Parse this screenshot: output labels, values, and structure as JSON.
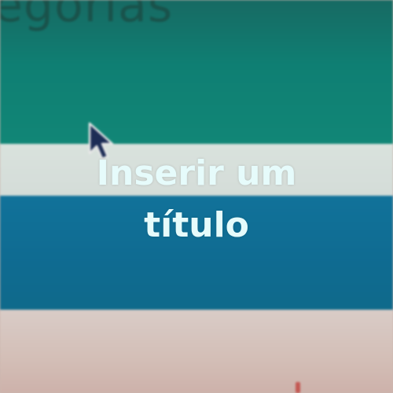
{
  "background": {
    "partial_heading": "egorias",
    "colors": {
      "top_band": "#0f7f73",
      "white_band": "#d6dfdb",
      "blue_band": "#0f6f95",
      "bottom_band": "#d3beb6",
      "title_text": "#e6fbfb"
    }
  },
  "overlay": {
    "title_line1": "Inserir um",
    "title_line2": "título"
  },
  "cursor": {
    "icon": "mouse-pointer-icon"
  }
}
